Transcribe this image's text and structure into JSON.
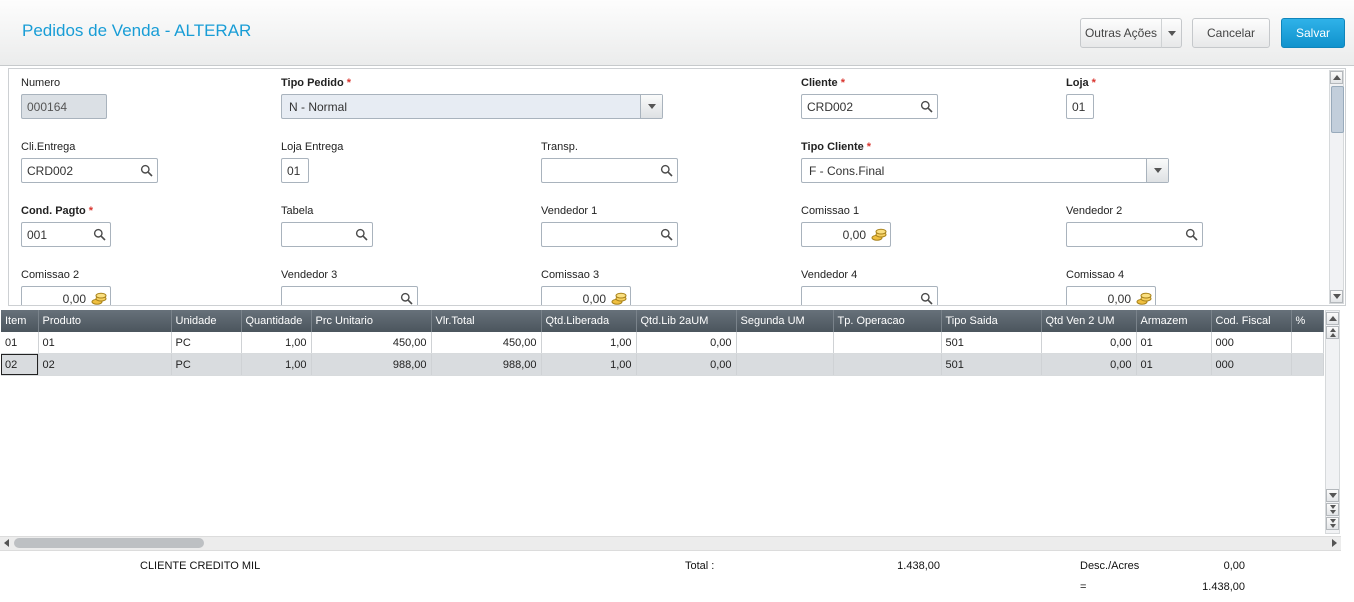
{
  "colors": {
    "accent": "#189dd6",
    "save_button": "#1092cd",
    "grid_header_bg": "#4b555d",
    "required_marker_color": "#d9352f",
    "selected_row_bg": "#d9dcdf"
  },
  "icons": {
    "search": "magnifier",
    "dropdown_caret": "triangle-down",
    "money": "gold-coins",
    "scroll_up": "triangle-up",
    "scroll_down": "triangle-down"
  },
  "header": {
    "title": "Pedidos de Venda - ALTERAR",
    "outras_acoes_label": "Outras Ações",
    "cancelar_label": "Cancelar",
    "salvar_label": "Salvar"
  },
  "form": {
    "required_marker": "*",
    "numero": {
      "label": "Numero",
      "value": "000164"
    },
    "tipo_pedido": {
      "label": "Tipo Pedido",
      "value": "N - Normal"
    },
    "cliente": {
      "label": "Cliente",
      "value": "CRD002"
    },
    "loja": {
      "label": "Loja",
      "value": "01"
    },
    "cli_entrega": {
      "label": "Cli.Entrega",
      "value": "CRD002"
    },
    "loja_entrega": {
      "label": "Loja Entrega",
      "value": "01"
    },
    "transp": {
      "label": "Transp.",
      "value": ""
    },
    "tipo_cliente": {
      "label": "Tipo Cliente",
      "value": "F - Cons.Final"
    },
    "cond_pagto": {
      "label": "Cond. Pagto",
      "value": "001"
    },
    "tabela": {
      "label": "Tabela",
      "value": ""
    },
    "vendedor1": {
      "label": "Vendedor 1",
      "value": ""
    },
    "comissao1": {
      "label": "Comissao 1",
      "value": "0,00"
    },
    "vendedor2": {
      "label": "Vendedor 2",
      "value": ""
    },
    "comissao2": {
      "label": "Comissao 2",
      "value": "0,00"
    },
    "vendedor3": {
      "label": "Vendedor 3",
      "value": ""
    },
    "comissao3": {
      "label": "Comissao 3",
      "value": "0,00"
    },
    "vendedor4": {
      "label": "Vendedor 4",
      "value": ""
    },
    "comissao4": {
      "label": "Comissao 4",
      "value": "0,00"
    }
  },
  "grid": {
    "columns": [
      "Item",
      "Produto",
      "Unidade",
      "Quantidade",
      "Prc Unitario",
      "Vlr.Total",
      "Qtd.Liberada",
      "Qtd.Lib 2aUM",
      "Segunda UM",
      "Tp. Operacao",
      "Tipo Saida",
      "Qtd Ven 2 UM",
      "Armazem",
      "Cod. Fiscal",
      "%"
    ],
    "rows": [
      [
        "01",
        "01",
        "PC",
        "1,00",
        "450,00",
        "450,00",
        "1,00",
        "0,00",
        "",
        "",
        "501",
        "0,00",
        "01",
        "000",
        ""
      ],
      [
        "02",
        "02",
        "PC",
        "1,00",
        "988,00",
        "988,00",
        "1,00",
        "0,00",
        "",
        "",
        "501",
        "0,00",
        "01",
        "000",
        ""
      ]
    ],
    "selected_row_index": 1
  },
  "footer": {
    "client_name": "CLIENTE CREDITO MIL",
    "total_label": "Total :",
    "total_value": "1.438,00",
    "desc_label": "Desc./Acres",
    "desc_value": "0,00",
    "equals_sign": "=",
    "final_total": "1.438,00"
  }
}
